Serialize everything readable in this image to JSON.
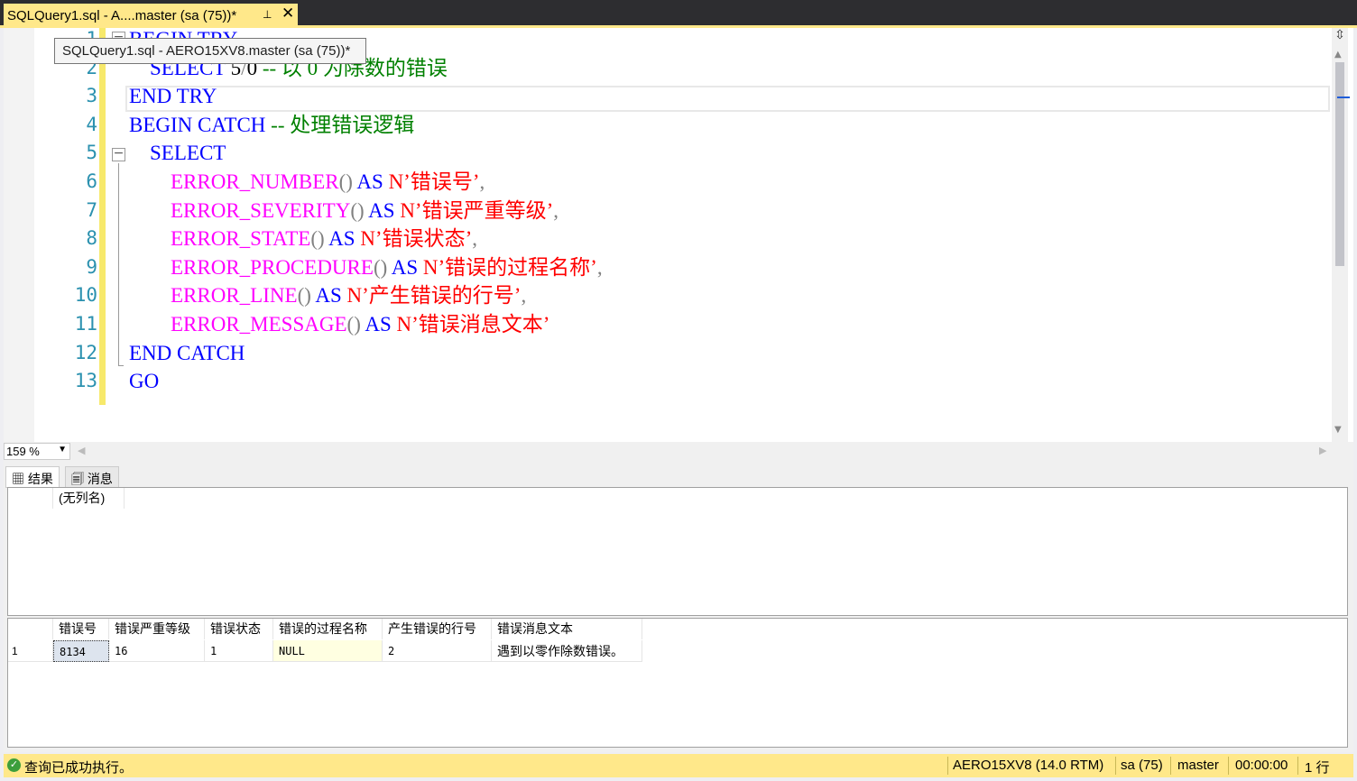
{
  "tab": {
    "title": "SQLQuery1.sql - A....master (sa (75))*",
    "pin": "⊥",
    "close": "✕"
  },
  "tooltip": "SQLQuery1.sql - AERO15XV8.master (sa (75))*",
  "editor": {
    "line_numbers": [
      "1",
      "2",
      "3",
      "4",
      "5",
      "6",
      "7",
      "8",
      "9",
      "10",
      "11",
      "12",
      "13"
    ],
    "lines": [
      {
        "parts": [
          {
            "t": "BEGIN TRY",
            "c": "kw"
          }
        ]
      },
      {
        "parts": [
          {
            "t": "    SELECT ",
            "c": "kw"
          },
          {
            "t": "5",
            "c": "blk"
          },
          {
            "t": "/",
            "c": "gray"
          },
          {
            "t": "0 ",
            "c": "blk"
          },
          {
            "t": "-- 以 0 为除数的错误",
            "c": "cm"
          }
        ]
      },
      {
        "parts": [
          {
            "t": "END TRY",
            "c": "kw"
          }
        ]
      },
      {
        "parts": [
          {
            "t": "BEGIN CATCH ",
            "c": "kw"
          },
          {
            "t": "-- 处理错误逻辑",
            "c": "cm"
          }
        ]
      },
      {
        "parts": [
          {
            "t": "    SELECT",
            "c": "kw"
          }
        ]
      },
      {
        "parts": [
          {
            "t": "        ERROR_NUMBER",
            "c": "fn"
          },
          {
            "t": "() ",
            "c": "gray"
          },
          {
            "t": "AS ",
            "c": "kw"
          },
          {
            "t": "N’错误号’",
            "c": "str"
          },
          {
            "t": ",",
            "c": "gray"
          }
        ]
      },
      {
        "parts": [
          {
            "t": "        ERROR_SEVERITY",
            "c": "fn"
          },
          {
            "t": "() ",
            "c": "gray"
          },
          {
            "t": "AS ",
            "c": "kw"
          },
          {
            "t": "N’错误严重等级’",
            "c": "str"
          },
          {
            "t": ",",
            "c": "gray"
          }
        ]
      },
      {
        "parts": [
          {
            "t": "        ERROR_STATE",
            "c": "fn"
          },
          {
            "t": "() ",
            "c": "gray"
          },
          {
            "t": "AS ",
            "c": "kw"
          },
          {
            "t": "N’错误状态’",
            "c": "str"
          },
          {
            "t": ",",
            "c": "gray"
          }
        ]
      },
      {
        "parts": [
          {
            "t": "        ERROR_PROCEDURE",
            "c": "fn"
          },
          {
            "t": "() ",
            "c": "gray"
          },
          {
            "t": "AS ",
            "c": "kw"
          },
          {
            "t": "N’错误的过程名称’",
            "c": "str"
          },
          {
            "t": ",",
            "c": "gray"
          }
        ]
      },
      {
        "parts": [
          {
            "t": "        ERROR_LINE",
            "c": "fn"
          },
          {
            "t": "() ",
            "c": "gray"
          },
          {
            "t": "AS ",
            "c": "kw"
          },
          {
            "t": "N’产生错误的行号’",
            "c": "str"
          },
          {
            "t": ",",
            "c": "gray"
          }
        ]
      },
      {
        "parts": [
          {
            "t": "        ERROR_MESSAGE",
            "c": "fn"
          },
          {
            "t": "() ",
            "c": "gray"
          },
          {
            "t": "AS ",
            "c": "kw"
          },
          {
            "t": "N’错误消息文本’",
            "c": "str"
          }
        ]
      },
      {
        "parts": [
          {
            "t": "END CATCH",
            "c": "kw"
          }
        ]
      },
      {
        "parts": [
          {
            "t": "GO",
            "c": "kw"
          }
        ]
      }
    ]
  },
  "zoom": {
    "value": "159 %",
    "arrow": "▼"
  },
  "results_tabs": {
    "results": "结果",
    "messages": "消息"
  },
  "grid1": {
    "header": "(无列名)"
  },
  "grid2": {
    "headers": [
      "错误号",
      "错误严重等级",
      "错误状态",
      "错误的过程名称",
      "产生错误的行号",
      "错误消息文本"
    ],
    "row_number": "1",
    "row": [
      "8134",
      "16",
      "1",
      "NULL",
      "2",
      "遇到以零作除数错误。"
    ]
  },
  "status": {
    "message": "查询已成功执行。",
    "server": "AERO15XV8 (14.0 RTM)",
    "user": "sa (75)",
    "database": "master",
    "elapsed": "00:00:00",
    "rows": "1 行"
  }
}
